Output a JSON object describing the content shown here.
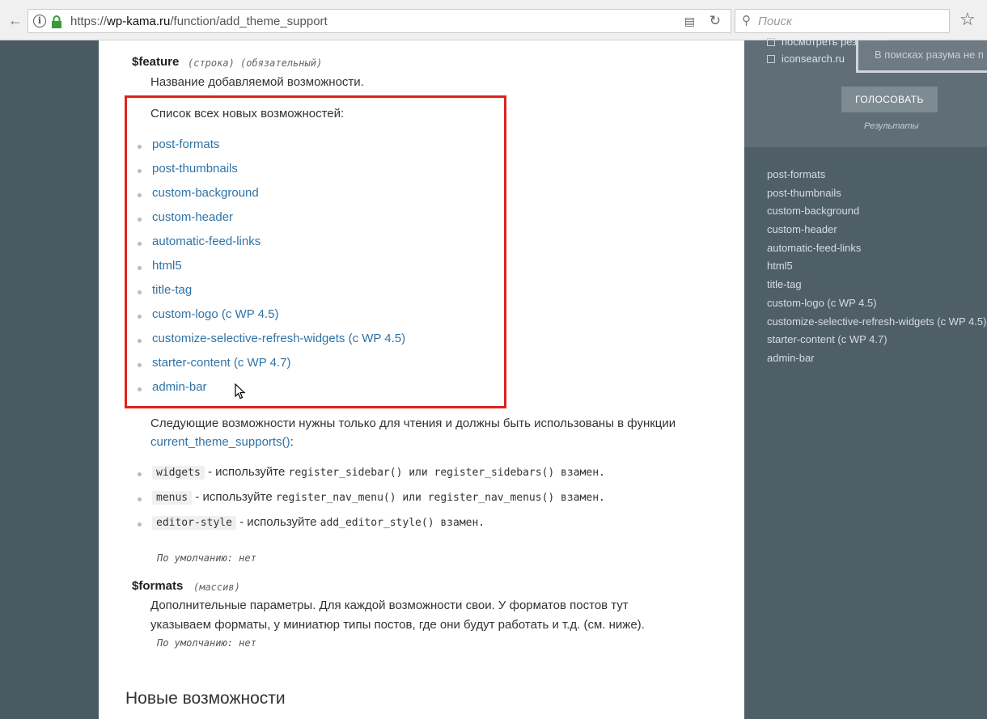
{
  "browser": {
    "url_prefix": "https://",
    "url_host": "wp-kama.ru",
    "url_path": "/function/add_theme_support",
    "search_placeholder": "Поиск"
  },
  "params": {
    "feature": {
      "name": "$feature",
      "meta": "(строка) (обязательный)",
      "desc": "Название добавляемой возможности.",
      "list_title": "Список всех новых возможностей:",
      "items": [
        "post-formats",
        "post-thumbnails",
        "custom-background",
        "custom-header",
        "automatic-feed-links",
        "html5",
        "title-tag",
        "custom-logo (с WP 4.5)",
        "customize-selective-refresh-widgets (с WP 4.5)",
        "starter-content (с WP 4.7)",
        "admin-bar"
      ],
      "readonly_intro": "Следующие возможности нужны только для чтения и должны быть использованы в функции",
      "readonly_link": "current_theme_supports()",
      "readonly_link_suffix": ":",
      "readonly_items": [
        {
          "code": "widgets",
          "text": " - используйте ",
          "mono": "register_sidebar() или register_sidebars() взамен."
        },
        {
          "code": "menus",
          "text": " - используйте ",
          "mono": "register_nav_menu() или register_nav_menus() взамен."
        },
        {
          "code": "editor-style",
          "text": " - используйте ",
          "mono": "add_editor_style() взамен."
        }
      ],
      "default": "По умолчанию: нет"
    },
    "formats": {
      "name": "$formats",
      "meta": "(массив)",
      "desc_line1": "Дополнительные параметры. Для каждой возможности свои. У форматов постов тут",
      "desc_line2": "указываем форматы, у миниатюр типы постов, где они будут работать и т.д. (см. ниже).",
      "default": "По умолчанию: нет"
    }
  },
  "section_heading": "Новые возможности",
  "sidebar": {
    "poll_options": [
      "посмотреть результат",
      "iconsearch.ru"
    ],
    "tooltip": "В поисках разума не п",
    "vote_label": "ГОЛОСОВАТЬ",
    "results_label": "Результаты",
    "toc": [
      "post-formats",
      "post-thumbnails",
      "custom-background",
      "custom-header",
      "automatic-feed-links",
      "html5",
      "title-tag",
      "custom-logo (с WP 4.5)",
      "customize-selective-refresh-widgets (с WP 4.5)",
      "starter-content (с WP 4.7)",
      "admin-bar"
    ]
  }
}
